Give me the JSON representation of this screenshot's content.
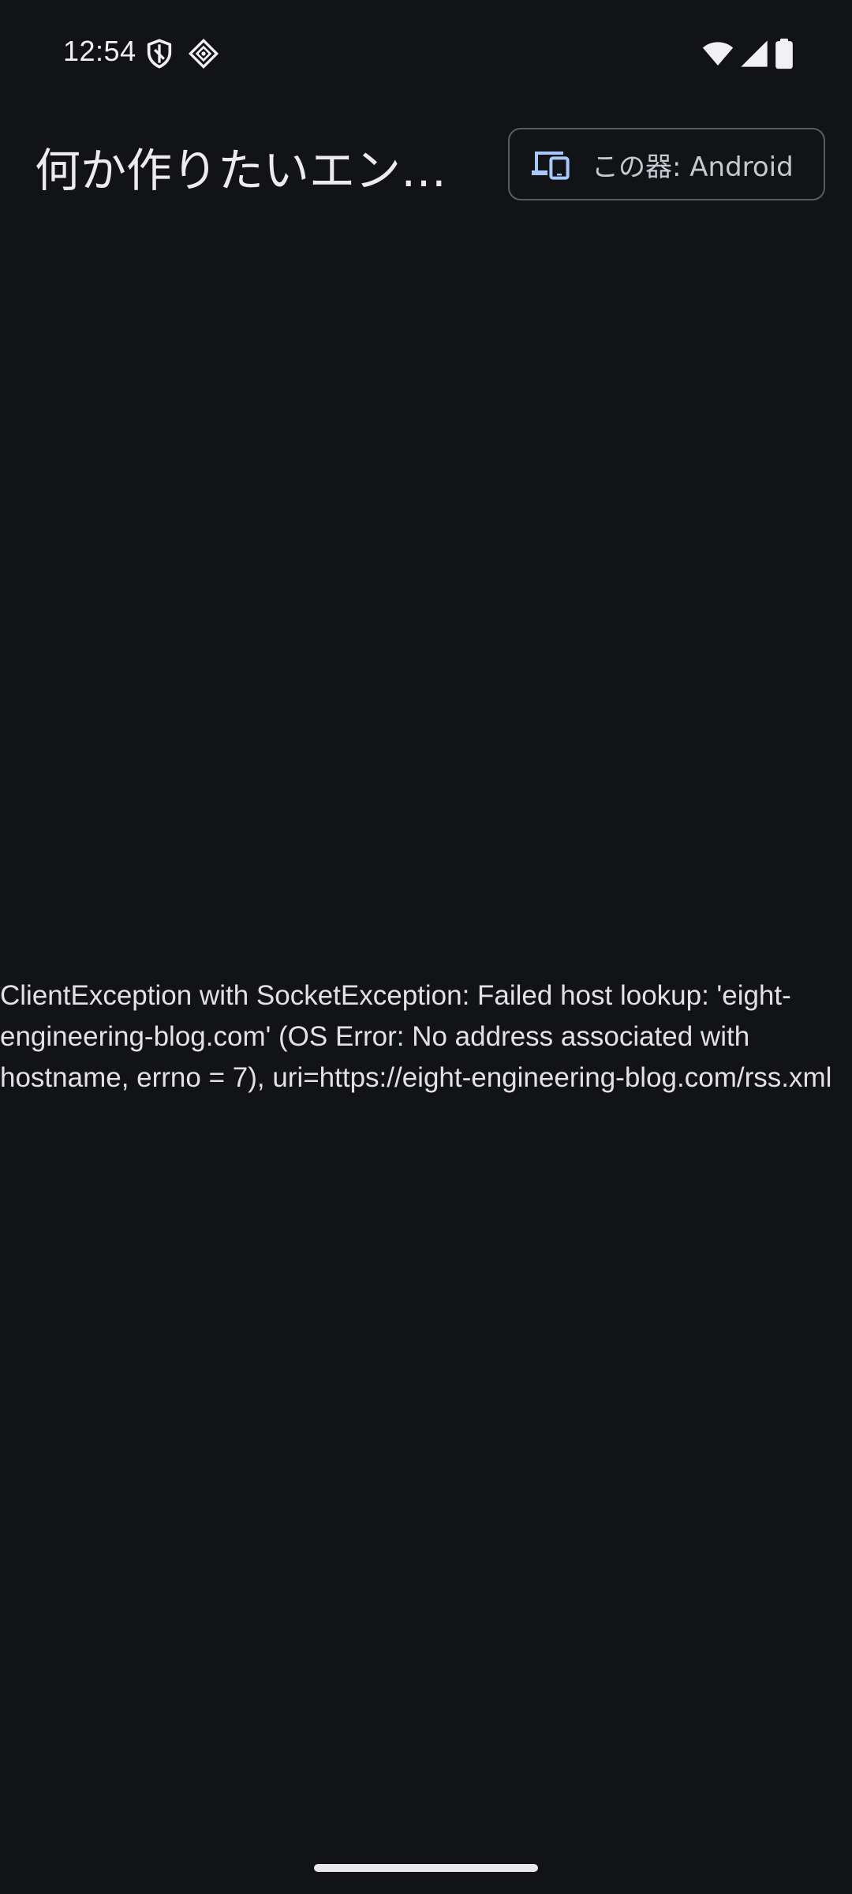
{
  "status_bar": {
    "time": "12:54",
    "icons": [
      "vpn-shield-icon",
      "app-notification-icon",
      "wifi-icon",
      "cell-signal-icon",
      "battery-icon"
    ]
  },
  "app_bar": {
    "title": "何か作りたいエン…",
    "device_button": {
      "icon": "devices-icon",
      "label": "この器: Android"
    }
  },
  "main": {
    "error_message": "ClientException with SocketException: Failed host lookup: 'eight-engineering-blog.com' (OS Error: No address associated with hostname, errno = 7), uri=https://eight-engineering-blog.com/rss.xml"
  },
  "colors": {
    "background": "#121317",
    "text": "#e2e2e6",
    "accent_icon": "#a8c7fa",
    "outline": "#5b5d66"
  }
}
